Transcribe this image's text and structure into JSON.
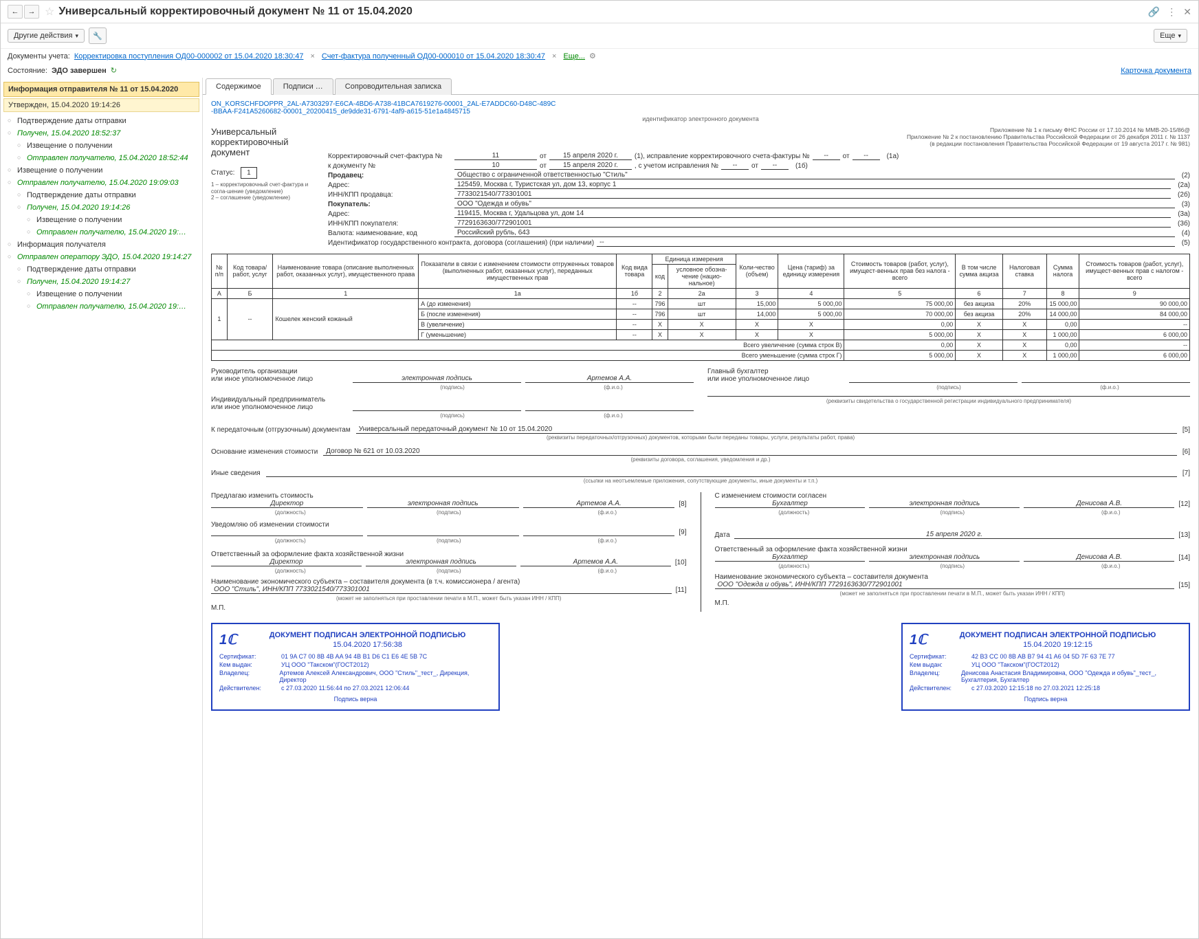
{
  "titlebar": {
    "title": "Универсальный корректировочный документ № 11 от 15.04.2020"
  },
  "toolbar": {
    "other_actions": "Другие действия",
    "more": "Еще"
  },
  "docs": {
    "label": "Документы учета:",
    "d1": "Корректировка поступления ОД00-000002 от 15.04.2020 18:30:47",
    "d2": "Счет-фактура полученный ОД00-000010 от 15.04.2020 18:30:47",
    "more": "Еще..."
  },
  "state": {
    "label": "Состояние:",
    "value": "ЭДО завершен",
    "card": "Карточка документа"
  },
  "sidebar": {
    "hdr": "Информация отправителя № 11 от 15.04.2020",
    "sub": "Утвержден, 15.04.2020 19:14:26",
    "items": [
      {
        "t": "Подтверждение даты отправки",
        "lvl": 1
      },
      {
        "t": "Получен, 15.04.2020 18:52:37",
        "lvl": 1,
        "g": true
      },
      {
        "t": "Извещение о получении",
        "lvl": 2
      },
      {
        "t": "Отправлен получателю, 15.04.2020 18:52:44",
        "lvl": 2,
        "g": true
      },
      {
        "t": "Извещение о получении",
        "lvl": 1
      },
      {
        "t": "Отправлен получателю, 15.04.2020 19:09:03",
        "lvl": 1,
        "g": true
      },
      {
        "t": "Подтверждение даты отправки",
        "lvl": 2
      },
      {
        "t": "Получен, 15.04.2020 19:14:26",
        "lvl": 2,
        "g": true
      },
      {
        "t": "Извещение о получении",
        "lvl": 3
      },
      {
        "t": "Отправлен получателю, 15.04.2020 19:…",
        "lvl": 3,
        "g": true
      },
      {
        "t": "Информация получателя",
        "lvl": 1
      },
      {
        "t": "Отправлен оператору ЭДО, 15.04.2020 19:14:27",
        "lvl": 1,
        "g": true
      },
      {
        "t": "Подтверждение даты отправки",
        "lvl": 2
      },
      {
        "t": "Получен, 15.04.2020 19:14:27",
        "lvl": 2,
        "g": true
      },
      {
        "t": "Извещение о получении",
        "lvl": 3
      },
      {
        "t": "Отправлен получателю, 15.04.2020 19:…",
        "lvl": 3,
        "g": true
      }
    ]
  },
  "tabs": {
    "t1": "Содержимое",
    "t2": "Подписи …",
    "t3": "Сопроводительная записка"
  },
  "doc": {
    "id1": "ON_KORSCHFDOPPR_2AL-A7303297-E6CA-4BD6-A738-41BCA7619276-00001_2AL-E7ADDC60-D48C-489C",
    "id2": "-BBAA-F241A5260682-00001_20200415_de9dde31-6791-4af9-a615-51e1a4845715",
    "id_cap": "идентификатор электронного документа",
    "uni": "Универсальный",
    "kor": "корректировочный",
    "dok": "документ",
    "status_lbl": "Статус:",
    "status": "1",
    "note": "1 – корректировочный счет-фактура и согла-шение (уведомление)\n2 – соглашение (уведомление)",
    "reg1": "Приложение № 1 к письму ФНС России от 17.10.2014 № ММВ-20-15/86@",
    "reg2": "Приложение № 2 к постановлению Правительства Российской Федерации от 26 декабря 2011 г. № 1137",
    "reg3": "(в редакции постановления Правительства Российской Федерации от 19 августа 2017 г. № 981)",
    "home_handoffs": {
      "label": "   "
    }
  },
  "fields": {
    "ksf": "Корректировочный счет-фактура №",
    "ksf_no": "11",
    "ksf_from": "от",
    "ksf_date": "15 апреля 2020 г.",
    "ksf_tail": "(1), исправление корректировочного счета-фактуры №",
    "ksf_d1": "--",
    "ksf_from2": "от",
    "ksf_d2": "--",
    "ksf_p": "(1а)",
    "kd": "к документу №",
    "kd_no": "10",
    "kd_from": "от",
    "kd_date": "15 апреля 2020 г.",
    "kd_tail": ", с учетом исправления №",
    "kd_d1": "--",
    "kd_from2": "от",
    "kd_d2": "--",
    "kd_p": "(1б)",
    "seller_lbl": "Продавец:",
    "seller": "Общество с ограниченной ответственностью \"Стиль\"",
    "seller_p": "(2)",
    "saddr_lbl": "Адрес:",
    "saddr": "125459, Москва г, Туристская ул, дом 13, корпус 1",
    "saddr_p": "(2а)",
    "sinn_lbl": "ИНН/КПП продавца:",
    "sinn": "7733021540/773301001",
    "sinn_p": "(2б)",
    "buyer_lbl": "Покупатель:",
    "buyer": "ООО \"Одежда и обувь\"",
    "buyer_p": "(3)",
    "baddr_lbl": "Адрес:",
    "baddr": "119415, Москва г, Удальцова ул, дом 14",
    "baddr_p": "(3а)",
    "binn_lbl": "ИНН/КПП покупателя:",
    "binn": "7729163630/772901001",
    "binn_p": "(3б)",
    "cur_lbl": "Валюта: наименование, код",
    "cur": "Российский рубль, 643",
    "cur_p": "(4)",
    "gk_lbl": "Идентификатор государственного контракта, договора (соглашения) (при наличии)",
    "gk": "--",
    "gk_p": "(5)"
  },
  "th": {
    "c0": "№ п/п",
    "c1": "Код товара/ работ, услуг",
    "c2": "Наименование товара (описание выполненных работ, оказанных услуг), имущественного права",
    "c3": "Показатели в связи с изменением стоимости отгруженных товаров (выполненных работ, оказанных услуг), переданных имущественных прав",
    "c4": "Код вида товара",
    "c5": "Единица измерения",
    "c5a": "код",
    "c5b": "условное обозна-чение (нацио-нальное)",
    "c6": "Коли-чество (объем)",
    "c7": "Цена (тариф) за единицу измерения",
    "c8": "Стоимость товаров (работ, услуг), имущест-венных прав без налога - всего",
    "c9": "В том числе сумма акциза",
    "c10": "Налоговая ставка",
    "c11": "Сумма налога",
    "c12": "Стоимость товаров (работ, услуг), имущест-венных прав с налогом - всего",
    "hA": "А",
    "hB": "Б",
    "h1": "1",
    "h1a": "1а",
    "h15": "1б",
    "h2": "2",
    "h2a": "2а",
    "h3": "3",
    "h4": "4",
    "h5": "5",
    "h6": "6",
    "h7": "7",
    "h8": "8",
    "h9": "9"
  },
  "rows": {
    "n": "1",
    "code": "--",
    "name": "Кошелек женский кожаный",
    "rA": "А (до изменения)",
    "rB": "Б (после изменения)",
    "rV": "В (увеличение)",
    "rG": "Г (уменьшение)",
    "A": {
      "kvt": "--",
      "k": "796",
      "u": "шт",
      "q": "15,000",
      "p": "5 000,00",
      "s": "75 000,00",
      "ak": "без акциза",
      "st": "20%",
      "tax": "15 000,00",
      "tot": "90 000,00"
    },
    "B": {
      "kvt": "--",
      "k": "796",
      "u": "шт",
      "q": "14,000",
      "p": "5 000,00",
      "s": "70 000,00",
      "ak": "без акциза",
      "st": "20%",
      "tax": "14 000,00",
      "tot": "84 000,00"
    },
    "V": {
      "kvt": "--",
      "k": "Х",
      "u": "Х",
      "q": "Х",
      "p": "Х",
      "s": "0,00",
      "ak": "Х",
      "st": "Х",
      "tax": "0,00",
      "tot": "--"
    },
    "G": {
      "kvt": "--",
      "k": "Х",
      "u": "Х",
      "q": "Х",
      "p": "Х",
      "s": "5 000,00",
      "ak": "Х",
      "st": "Х",
      "tax": "1 000,00",
      "tot": "6 000,00"
    },
    "totV_lbl": "Всего увеличение (сумма строк В)",
    "totV": {
      "s": "0,00",
      "ak": "Х",
      "st": "Х",
      "tax": "0,00",
      "tot": "--"
    },
    "totG_lbl": "Всего уменьшение (сумма строк Г)",
    "totG": {
      "s": "5 000,00",
      "ak": "Х",
      "st": "Х",
      "tax": "1 000,00",
      "tot": "6 000,00"
    }
  },
  "sig": {
    "ruk": "Руководитель организации",
    "ili": "или иное уполномоченное лицо",
    "ep": "электронная подпись",
    "art": "Артемов А.А.",
    "glav": "Главный бухгалтер",
    "ip": "Индивидуальный предприниматель",
    "pod": "(подпись)",
    "fio": "(ф.и.о.)",
    "rekv": "(реквизиты свидетельства о государственной  регистрации индивидуального предпринимателя)"
  },
  "transfer": {
    "lbl": "К передаточным (отгрузочным) документам",
    "val": "Универсальный передаточный документ № 10 от 15.04.2020",
    "p": "[5]",
    "cap": "(реквизиты передаточных/отгрузочных) документов, которыми были переданы товары, услуги, результаты работ, права)",
    "osn_lbl": "Основание изменения стоимости",
    "osn": "Договор № 621 от 10.03.2020",
    "osn_p": "[6]",
    "osn_cap": "(реквизиты договора, соглашения, уведомления и др.)",
    "inye": "Иные сведения",
    "inye_p": "[7]",
    "inye_cap": "(ссылки на неотъемлемые приложения, сопутствующие документы, иные документы и т.п.)"
  },
  "bottom": {
    "l1": "Предлагаю изменить стоимость",
    "r1": "С изменением стоимости согласен",
    "dir": "Директор",
    "buh": "Бухгалтер",
    "den": "Денисова А.В.",
    "art": "Артемов А.А.",
    "ep": "электронная подпись",
    "p8": "[8]",
    "p12": "[12]",
    "p9": "[9]",
    "p13": "[13]",
    "p10": "[10]",
    "p14": "[14]",
    "p11": "[11]",
    "p15": "[15]",
    "uved": "Уведомляю об изменении стоимости",
    "date_lbl": "Дата",
    "date": "15 апреля 2020 г.",
    "otv": "Ответственный за оформление факта хозяйственной жизни",
    "naim_l": "Наименование экономического субъекта – составителя документа (в т.ч. комиссионера / агента)",
    "naim_r": "Наименование экономического субъекта – составителя документа",
    "org_l": "ООО \"Стиль\", ИНН/КПП 7733021540/773301001",
    "org_r": "ООО \"Одежда и обувь\", ИНН/КПП 7729163630/772901001",
    "mp": "М.П.",
    "mp_note": "(может не заполняться при проставлении печати в М.П., может быть указан ИНН / КПП)",
    "dolzh": "(должность)"
  },
  "stamps": {
    "title": "ДОКУМЕНТ ПОДПИСАН ЭЛЕКТРОННОЙ ПОДПИСЬЮ",
    "cert": "Сертификат:",
    "issued": "Кем выдан:",
    "owner": "Владелец:",
    "valid": "Действителен:",
    "ft": "Подпись верна",
    "l": {
      "date": "15.04.2020 17:56:38",
      "cert": "01 9A C7 00 8B 4B AA 94 4B B1 D6 C1 E6 4E 5B 7C",
      "issued": "УЦ ООО \"Такском\"(ГОСТ2012)",
      "owner": "Артемов Алексей Александрович, ООО \"Стиль\"_тест_, Дирекция, Директор",
      "valid": "с 27.03.2020 11:56:44 по 27.03.2021 12:06:44"
    },
    "r": {
      "date": "15.04.2020 19:12:15",
      "cert": "42 B3 CC 00 8B AB B7 94 41 A6 04 5D 7F 63 7E 77",
      "issued": "УЦ ООО \"Такском\"(ГОСТ2012)",
      "owner": "Денисова Анастасия Владимировна, ООО \"Одежда и обувь\"_тест_, Бухгалтерия, Бухгалтер",
      "valid": "с 27.03.2020 12:15:18 по 27.03.2021 12:25:18"
    }
  }
}
